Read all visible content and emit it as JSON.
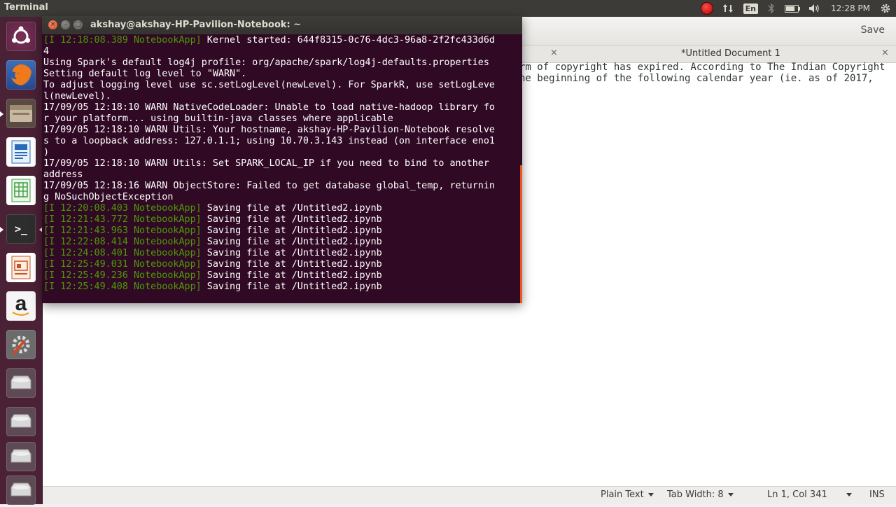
{
  "top_panel": {
    "app_title": "Terminal",
    "language": "En",
    "time": "12:28 PM"
  },
  "launcher": {
    "items": [
      {
        "name": "ubuntu-dash-icon",
        "color": "#e95420"
      },
      {
        "name": "firefox-icon",
        "color": "#e66000"
      },
      {
        "name": "files-icon",
        "color": "#8a7a66"
      },
      {
        "name": "libreoffice-writer-icon",
        "color": "#2a6bb8"
      },
      {
        "name": "libreoffice-calc-icon",
        "color": "#3a9b3a"
      },
      {
        "name": "terminal-icon",
        "color": "#2d2d2d"
      },
      {
        "name": "libreoffice-impress-icon",
        "color": "#c9541f"
      },
      {
        "name": "amazon-icon",
        "color": "#222222"
      },
      {
        "name": "system-settings-icon",
        "color": "#777777"
      },
      {
        "name": "drive-icon",
        "color": "#bdbdbd"
      },
      {
        "name": "drive-icon",
        "color": "#bdbdbd"
      },
      {
        "name": "drive-icon",
        "color": "#bdbdbd"
      },
      {
        "name": "drive-icon",
        "color": "#bdbdbd"
      }
    ],
    "terminal_glyph": ">_",
    "amazon_glyph": "a"
  },
  "gedit": {
    "save_label": "Save",
    "tab_close": "×",
    "tab_title": "*Untitled Document 1",
    "editor_lines": [
      "rm of copyright has expired. According to The Indian Copyright",
      "he beginning of the following calendar year (ie. as of 2017,  "
    ],
    "status": {
      "language": "Plain Text",
      "tab_width": "Tab Width: 8",
      "position": "Ln 1, Col 341",
      "mode": "INS"
    }
  },
  "terminal": {
    "title": "akshay@akshay-HP-Pavilion-Notebook: ~",
    "lines": [
      {
        "prefix": "[I 12:18:08.389 NotebookApp]",
        "text": " Kernel started: 644f8315-0c76-4dc3-96a8-2f2fc433d6d"
      },
      {
        "prefix": "",
        "text": "4"
      },
      {
        "prefix": "",
        "text": "Using Spark's default log4j profile: org/apache/spark/log4j-defaults.properties"
      },
      {
        "prefix": "",
        "text": "Setting default log level to \"WARN\"."
      },
      {
        "prefix": "",
        "text": "To adjust logging level use sc.setLogLevel(newLevel). For SparkR, use setLogLeve"
      },
      {
        "prefix": "",
        "text": "l(newLevel)."
      },
      {
        "prefix": "",
        "text": "17/09/05 12:18:10 WARN NativeCodeLoader: Unable to load native-hadoop library fo"
      },
      {
        "prefix": "",
        "text": "r your platform... using builtin-java classes where applicable"
      },
      {
        "prefix": "",
        "text": "17/09/05 12:18:10 WARN Utils: Your hostname, akshay-HP-Pavilion-Notebook resolve"
      },
      {
        "prefix": "",
        "text": "s to a loopback address: 127.0.1.1; using 10.70.3.143 instead (on interface eno1"
      },
      {
        "prefix": "",
        "text": ")"
      },
      {
        "prefix": "",
        "text": "17/09/05 12:18:10 WARN Utils: Set SPARK_LOCAL_IP if you need to bind to another"
      },
      {
        "prefix": "",
        "text": "address"
      },
      {
        "prefix": "",
        "text": "17/09/05 12:18:16 WARN ObjectStore: Failed to get database global_temp, returnin"
      },
      {
        "prefix": "",
        "text": "g NoSuchObjectException"
      },
      {
        "prefix": "[I 12:20:08.403 NotebookApp]",
        "text": " Saving file at /Untitled2.ipynb"
      },
      {
        "prefix": "[I 12:21:43.772 NotebookApp]",
        "text": " Saving file at /Untitled2.ipynb"
      },
      {
        "prefix": "[I 12:21:43.963 NotebookApp]",
        "text": " Saving file at /Untitled2.ipynb"
      },
      {
        "prefix": "[I 12:22:08.414 NotebookApp]",
        "text": " Saving file at /Untitled2.ipynb"
      },
      {
        "prefix": "[I 12:24:08.401 NotebookApp]",
        "text": " Saving file at /Untitled2.ipynb"
      },
      {
        "prefix": "[I 12:25:49.031 NotebookApp]",
        "text": " Saving file at /Untitled2.ipynb"
      },
      {
        "prefix": "[I 12:25:49.236 NotebookApp]",
        "text": " Saving file at /Untitled2.ipynb"
      },
      {
        "prefix": "[I 12:25:49.408 NotebookApp]",
        "text": " Saving file at /Untitled2.ipynb"
      }
    ]
  },
  "colors": {
    "terminal_bg": "#300a24",
    "prefix_green": "#4e9a06",
    "launcher_bg": "#4a2135",
    "accent": "#e95420"
  }
}
